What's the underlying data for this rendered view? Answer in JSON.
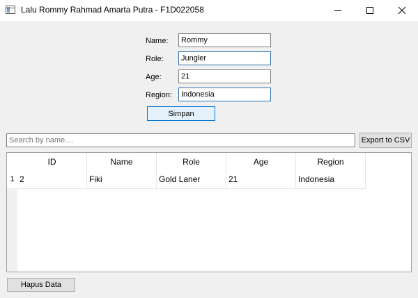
{
  "window": {
    "title": "Lalu Rommy Rahmad Amarta Putra - F1D022058"
  },
  "form": {
    "name_label": "Name:",
    "name_value": "Rommy",
    "role_label": "Role:",
    "role_value": "Jungler",
    "age_label": "Age:",
    "age_value": "21",
    "region_label": "Region:",
    "region_value": "Indonesia",
    "save_label": "Simpan"
  },
  "search": {
    "placeholder": "Search by name....",
    "export_label": "Export to CSV"
  },
  "table": {
    "headers": [
      "ID",
      "Name",
      "Role",
      "Age",
      "Region"
    ],
    "rows": [
      {
        "num": "1",
        "cells": [
          "2",
          "Fiki",
          "Gold Laner",
          "21",
          "Indonesia"
        ]
      }
    ]
  },
  "footer": {
    "delete_label": "Hapus Data"
  },
  "colors": {
    "focus_border": "#2c6fad",
    "default_button_border": "#0078d7",
    "window_bg": "#f0f0f0"
  }
}
